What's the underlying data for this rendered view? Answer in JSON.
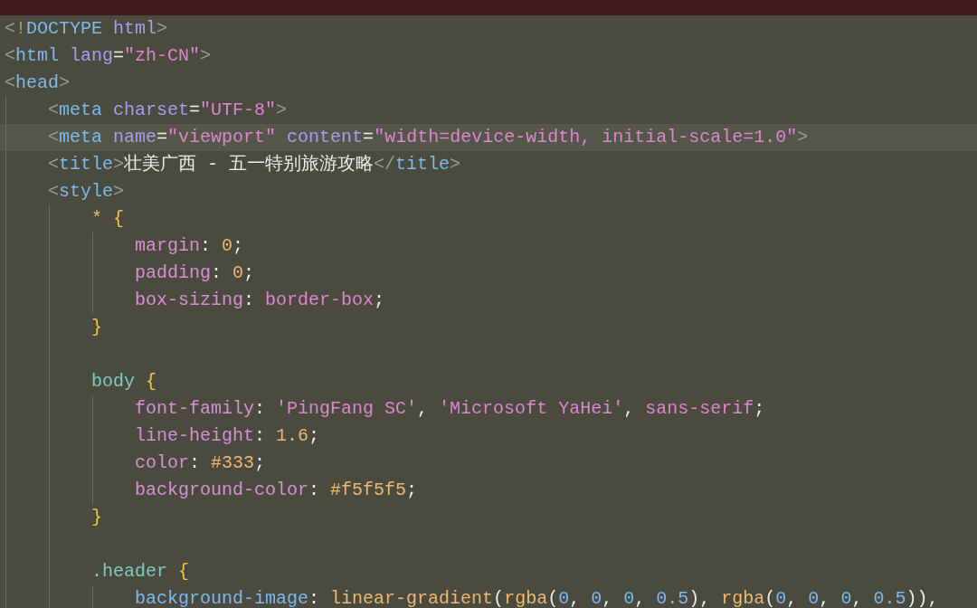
{
  "editor": {
    "lines": [
      {
        "highlighted": false,
        "tokens": [
          {
            "kind": "punct",
            "text": "<!"
          },
          {
            "kind": "tag",
            "text": "DOCTYPE"
          },
          {
            "kind": "attr",
            "text": " html"
          },
          {
            "kind": "punct",
            "text": ">"
          }
        ]
      },
      {
        "highlighted": false,
        "tokens": [
          {
            "kind": "punct",
            "text": "<"
          },
          {
            "kind": "tag",
            "text": "html"
          },
          {
            "kind": "attr",
            "text": " lang"
          },
          {
            "kind": "plain",
            "text": "="
          },
          {
            "kind": "string",
            "text": "\"zh-CN\""
          },
          {
            "kind": "punct",
            "text": ">"
          }
        ]
      },
      {
        "highlighted": false,
        "tokens": [
          {
            "kind": "punct",
            "text": "<"
          },
          {
            "kind": "tag",
            "text": "head"
          },
          {
            "kind": "punct",
            "text": ">"
          }
        ]
      },
      {
        "highlighted": false,
        "tokens": [
          {
            "kind": "punct",
            "text": "    <"
          },
          {
            "kind": "tag",
            "text": "meta"
          },
          {
            "kind": "attr",
            "text": " charset"
          },
          {
            "kind": "plain",
            "text": "="
          },
          {
            "kind": "string",
            "text": "\"UTF-8\""
          },
          {
            "kind": "punct",
            "text": ">"
          }
        ]
      },
      {
        "highlighted": true,
        "tokens": [
          {
            "kind": "punct",
            "text": "    <"
          },
          {
            "kind": "tag",
            "text": "meta"
          },
          {
            "kind": "attr",
            "text": " name"
          },
          {
            "kind": "plain",
            "text": "="
          },
          {
            "kind": "string",
            "text": "\"viewport\""
          },
          {
            "kind": "attr",
            "text": " content"
          },
          {
            "kind": "plain",
            "text": "="
          },
          {
            "kind": "string",
            "text": "\"width=device-width, initial-scale=1.0\""
          },
          {
            "kind": "punct",
            "text": ">"
          }
        ]
      },
      {
        "highlighted": false,
        "tokens": [
          {
            "kind": "punct",
            "text": "    <"
          },
          {
            "kind": "tag",
            "text": "title"
          },
          {
            "kind": "punct",
            "text": ">"
          },
          {
            "kind": "plain",
            "text": "壮美广西 - 五一特别旅游攻略"
          },
          {
            "kind": "punct",
            "text": "</"
          },
          {
            "kind": "tag",
            "text": "title"
          },
          {
            "kind": "punct",
            "text": ">"
          }
        ]
      },
      {
        "highlighted": false,
        "tokens": [
          {
            "kind": "punct",
            "text": "    <"
          },
          {
            "kind": "tag",
            "text": "style"
          },
          {
            "kind": "punct",
            "text": ">"
          }
        ]
      },
      {
        "highlighted": false,
        "tokens": [
          {
            "kind": "value",
            "text": "        *"
          },
          {
            "kind": "brace",
            "text": " {"
          }
        ]
      },
      {
        "highlighted": false,
        "tokens": [
          {
            "kind": "property",
            "text": "            margin"
          },
          {
            "kind": "plain",
            "text": ": "
          },
          {
            "kind": "value",
            "text": "0"
          },
          {
            "kind": "plain",
            "text": ";"
          }
        ]
      },
      {
        "highlighted": false,
        "tokens": [
          {
            "kind": "property",
            "text": "            padding"
          },
          {
            "kind": "plain",
            "text": ": "
          },
          {
            "kind": "value",
            "text": "0"
          },
          {
            "kind": "plain",
            "text": ";"
          }
        ]
      },
      {
        "highlighted": false,
        "tokens": [
          {
            "kind": "property",
            "text": "            box-sizing"
          },
          {
            "kind": "plain",
            "text": ": "
          },
          {
            "kind": "string",
            "text": "border-box"
          },
          {
            "kind": "plain",
            "text": ";"
          }
        ]
      },
      {
        "highlighted": false,
        "tokens": [
          {
            "kind": "brace",
            "text": "        }"
          }
        ]
      },
      {
        "highlighted": false
      },
      {
        "highlighted": false,
        "tokens": [
          {
            "kind": "selector",
            "text": "        body"
          },
          {
            "kind": "brace",
            "text": " {"
          }
        ]
      },
      {
        "highlighted": false,
        "tokens": [
          {
            "kind": "property",
            "text": "            font-family"
          },
          {
            "kind": "plain",
            "text": ": "
          },
          {
            "kind": "string",
            "text": "'PingFang SC'"
          },
          {
            "kind": "plain",
            "text": ", "
          },
          {
            "kind": "string",
            "text": "'Microsoft YaHei'"
          },
          {
            "kind": "plain",
            "text": ", "
          },
          {
            "kind": "string",
            "text": "sans-serif"
          },
          {
            "kind": "plain",
            "text": ";"
          }
        ]
      },
      {
        "highlighted": false,
        "tokens": [
          {
            "kind": "property",
            "text": "            line-height"
          },
          {
            "kind": "plain",
            "text": ": "
          },
          {
            "kind": "value",
            "text": "1.6"
          },
          {
            "kind": "plain",
            "text": ";"
          }
        ]
      },
      {
        "highlighted": false,
        "tokens": [
          {
            "kind": "property",
            "text": "            color"
          },
          {
            "kind": "plain",
            "text": ": "
          },
          {
            "kind": "value",
            "text": "#333"
          },
          {
            "kind": "plain",
            "text": ";"
          }
        ]
      },
      {
        "highlighted": false,
        "tokens": [
          {
            "kind": "property",
            "text": "            background-color"
          },
          {
            "kind": "plain",
            "text": ": "
          },
          {
            "kind": "value",
            "text": "#f5f5f5"
          },
          {
            "kind": "plain",
            "text": ";"
          }
        ]
      },
      {
        "highlighted": false,
        "tokens": [
          {
            "kind": "brace",
            "text": "        }"
          }
        ]
      },
      {
        "highlighted": false
      },
      {
        "highlighted": false,
        "tokens": [
          {
            "kind": "selector",
            "text": "        .header"
          },
          {
            "kind": "brace",
            "text": " {"
          }
        ]
      },
      {
        "highlighted": false,
        "tokens": [
          {
            "kind": "tag",
            "text": "            background-image"
          },
          {
            "kind": "plain",
            "text": ": "
          },
          {
            "kind": "value",
            "text": "linear-gradient"
          },
          {
            "kind": "plain",
            "text": "("
          },
          {
            "kind": "value",
            "text": "rgba"
          },
          {
            "kind": "plain",
            "text": "("
          },
          {
            "kind": "tag",
            "text": "0"
          },
          {
            "kind": "plain",
            "text": ", "
          },
          {
            "kind": "tag",
            "text": "0"
          },
          {
            "kind": "plain",
            "text": ", "
          },
          {
            "kind": "tag",
            "text": "0"
          },
          {
            "kind": "plain",
            "text": ", "
          },
          {
            "kind": "tag",
            "text": "0.5"
          },
          {
            "kind": "plain",
            "text": "), "
          },
          {
            "kind": "value",
            "text": "rgba"
          },
          {
            "kind": "plain",
            "text": "("
          },
          {
            "kind": "tag",
            "text": "0"
          },
          {
            "kind": "plain",
            "text": ", "
          },
          {
            "kind": "tag",
            "text": "0"
          },
          {
            "kind": "plain",
            "text": ", "
          },
          {
            "kind": "tag",
            "text": "0"
          },
          {
            "kind": "plain",
            "text": ", "
          },
          {
            "kind": "tag",
            "text": "0.5"
          },
          {
            "kind": "plain",
            "text": ")),"
          }
        ]
      }
    ]
  }
}
